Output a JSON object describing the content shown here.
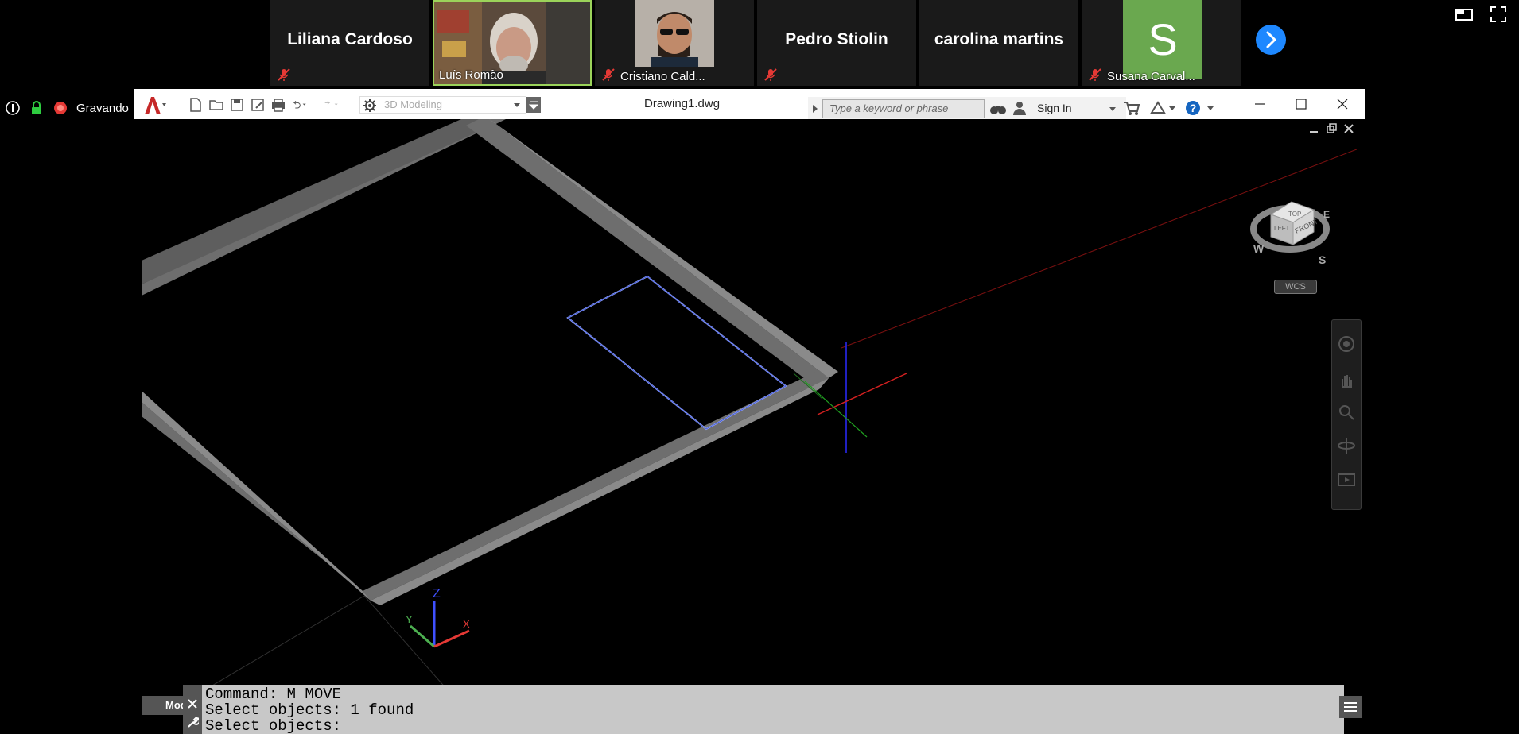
{
  "meeting": {
    "participants": [
      {
        "name": "Liliana Cardoso",
        "video": false,
        "muted": true
      },
      {
        "name": "Luís Romão",
        "video": true,
        "muted": false,
        "active": true
      },
      {
        "name": "Cristiano Cald...",
        "video": true,
        "muted": true
      },
      {
        "name": "Pedro Stiolin",
        "video": false,
        "muted": true
      },
      {
        "name": "carolina martins",
        "video": false,
        "muted": false
      },
      {
        "name": "Susana Carval...",
        "video": false,
        "avatar_letter": "S",
        "avatar_color": "#6aa84f",
        "muted": true
      }
    ],
    "recording_label": "Gravando",
    "next_icon": "chevron-right-icon"
  },
  "autocad": {
    "document_title": "Drawing1.dwg",
    "workspace_placeholder": "3D Modeling",
    "search_placeholder": "Type a keyword or phrase",
    "signin_label": "Sign In",
    "wcs_label": "WCS",
    "viewcube": {
      "top": "TOP",
      "front": "FRONT",
      "left": "LEFT",
      "compass": [
        "W",
        "S",
        "E"
      ]
    },
    "ucs_labels": {
      "z": "Z",
      "y": "Y",
      "x": "X"
    },
    "model_tab": "Mod",
    "command_history": [
      "Command: M MOVE",
      "Select objects: 1 found",
      "Select objects:"
    ]
  },
  "colors": {
    "accent_green": "#9bd35a",
    "mute_red": "#e53935",
    "selection_blue": "#9aaeff",
    "floor_gray": "#6e6e6e",
    "ucs_x": "#e53935",
    "ucs_y": "#4caf50",
    "ucs_z": "#3f51ff"
  }
}
